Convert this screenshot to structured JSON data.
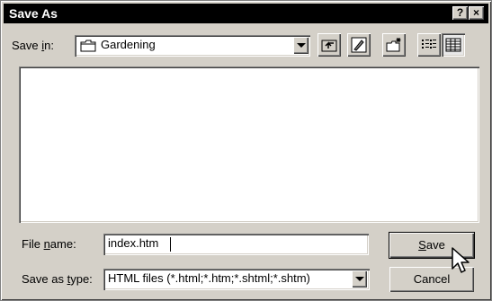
{
  "dialog": {
    "title": "Save As",
    "help_label": "?",
    "close_label": "×"
  },
  "save_in": {
    "label_prefix": "Save ",
    "label_underline": "i",
    "label_suffix": "n:",
    "value": "Gardening"
  },
  "toolbar": {
    "icons": [
      "up-one-level-icon",
      "desktop-icon",
      "new-folder-icon",
      "list-view-icon",
      "details-view-icon"
    ]
  },
  "file_name": {
    "label_prefix": "File ",
    "label_underline": "n",
    "label_suffix": "ame:",
    "value": "index.htm"
  },
  "save_as_type": {
    "label_prefix": "Save as ",
    "label_underline": "t",
    "label_suffix": "ype:",
    "value": "HTML files (*.html;*.htm;*.shtml;*.shtm)"
  },
  "buttons": {
    "save_underline": "S",
    "save_rest": "ave",
    "cancel_label": "Cancel"
  }
}
